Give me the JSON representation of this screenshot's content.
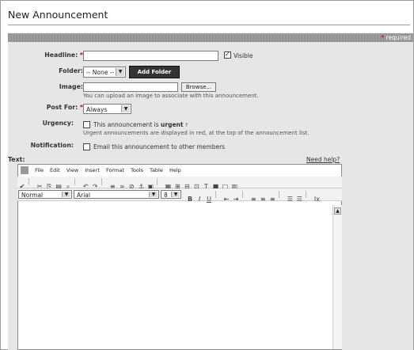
{
  "page": {
    "title": "New Announcement"
  },
  "header": {
    "required_asterisk": "*",
    "required_label": "required"
  },
  "form": {
    "headline": {
      "label": "Headline:",
      "value": "",
      "visible_checked": true,
      "visible_label": "Visible"
    },
    "folder": {
      "label": "Folder:",
      "selected": "-- None --",
      "add_folder_label": "Add Folder"
    },
    "image": {
      "label": "Image:",
      "browse_label": "Browse...",
      "hint": "You can upload an image to associate with this announcement."
    },
    "post_for": {
      "label": "Post For:",
      "selected": "Always"
    },
    "urgency": {
      "label": "Urgency:",
      "text": "This announcement is",
      "bold": "urgent",
      "help_mark": "?",
      "hint": "Urgent announcements are displayed in red, at the top of the announcement list.",
      "checked": false
    },
    "notification": {
      "label": "Notification:",
      "text": "Email this announcement to other members",
      "checked": false
    },
    "text": {
      "label": "Text:",
      "help_link": "Need help?"
    }
  },
  "editor": {
    "menu": [
      "File",
      "Edit",
      "View",
      "Insert",
      "Format",
      "Tools",
      "Table",
      "Help"
    ],
    "style_selected": "Normal",
    "font_selected": "Arial",
    "size_selected": "8",
    "content": ""
  },
  "colors": {
    "required_star": "#cc0000",
    "dark_button": "#333333",
    "form_bg": "#e6e6e6"
  }
}
